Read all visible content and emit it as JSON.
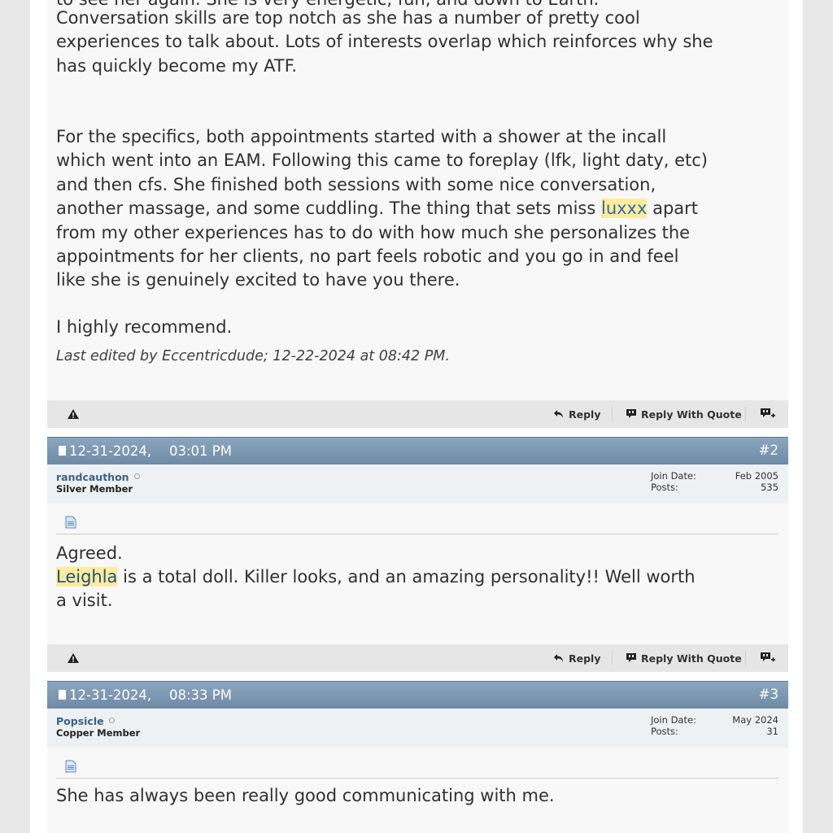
{
  "post1": {
    "partial_line": "to see her again. She is very energetic, fun, and down to Earth.",
    "para1": "Conversation skills are top notch as she has a number of pretty cool\nexperiences to talk about. Lots of interests overlap which reinforces why she\nhas quickly become my ATF.",
    "para2_a": "For the specifics, both appointments started with a shower at the incall\nwhich went into an EAM. Following this came to foreplay (lfk, light daty, etc)\nand then cfs. She finished both sessions with some nice conversation,\nanother massage, and some cuddling. The thing that sets miss ",
    "para2_hl": "luxxx",
    "para2_b": " apart\nfrom my other experiences has to do with how much she personalizes the\nappointments for her clients, no part feels robotic and you go in and feel\nlike she is genuinely excited to have you there.",
    "para3": "I highly recommend.",
    "edited": "Last edited by Eccentricdude; 12-22-2024 at 08:42 PM."
  },
  "actions": {
    "reply": "Reply",
    "reply_quote": "Reply With Quote"
  },
  "post2": {
    "date": "12-31-2024,",
    "time": "03:01 PM",
    "num": "#2",
    "username": "randcauthon",
    "rank": "Silver Member",
    "join_label": "Join Date:",
    "join_value": "Feb 2005",
    "posts_label": "Posts:",
    "posts_value": "535",
    "line1": "Agreed.",
    "hl": "Leighla",
    "line2": " is a total doll. Killer looks, and an amazing personality!! Well worth\na visit."
  },
  "post3": {
    "date": "12-31-2024,",
    "time": "08:33 PM",
    "num": "#3",
    "username": "Popsicle",
    "rank": "Copper Member",
    "join_label": "Join Date:",
    "join_value": "May 2024",
    "posts_label": "Posts:",
    "posts_value": "31",
    "line1": "She has always been really good communicating with me."
  },
  "colors": {
    "header": "#7a93ad",
    "highlight": "#fbec9f",
    "username": "#3c6184"
  },
  "icons": [
    "warning-icon",
    "reply-icon",
    "quote-icon",
    "multiquote-icon",
    "post-icon",
    "document-icon"
  ]
}
